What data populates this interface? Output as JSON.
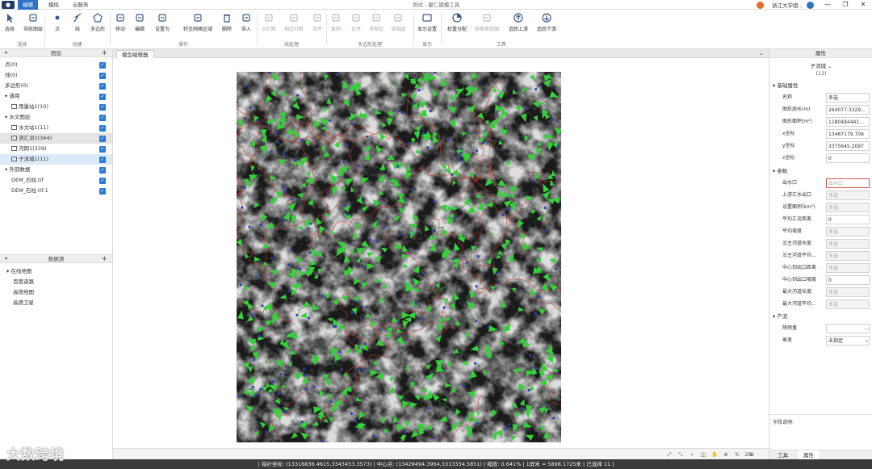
{
  "titlebar": {
    "app_title": "测试 - 量仁建模工具",
    "tabs": [
      "编辑",
      "模拟",
      "云服务"
    ],
    "active_tab": "编辑",
    "user_name": "浙江大学祖…",
    "win_min": "—",
    "win_restore": "❐",
    "win_close": "✕"
  },
  "ribbon": {
    "tools": [
      {
        "label": "选择",
        "icon": "cursor-icon"
      },
      {
        "label": "导航图层",
        "icon": "nav-layer-icon"
      },
      {
        "label": "点",
        "icon": "point-icon"
      },
      {
        "label": "线",
        "icon": "line-icon"
      },
      {
        "label": "多边形",
        "icon": "polygon-icon"
      },
      {
        "label": "移动",
        "icon": "move-icon"
      },
      {
        "label": "编辑",
        "icon": "pencil-icon"
      },
      {
        "label": "设置为",
        "icon": "set-as-icon"
      },
      {
        "label": "转至网格区域",
        "icon": "swap-icon"
      },
      {
        "label": "删除",
        "icon": "trash-icon"
      },
      {
        "label": "导入",
        "icon": "import-icon"
      },
      {
        "label": "点打断",
        "icon": "point-break-icon"
      },
      {
        "label": "相交打断",
        "icon": "intersect-break-icon"
      },
      {
        "label": "合并",
        "icon": "merge-icon"
      },
      {
        "label": "复制",
        "icon": "copy-icon"
      },
      {
        "label": "合并",
        "icon": "merge2-icon"
      },
      {
        "label": "求相交",
        "icon": "intersect-icon"
      },
      {
        "label": "求相减",
        "icon": "subtract-icon"
      },
      {
        "label": "显示设置",
        "icon": "display-icon"
      },
      {
        "label": "权重分配",
        "icon": "pie-icon"
      },
      {
        "label": "纵断面视图",
        "icon": "profile-icon"
      },
      {
        "label": "追踪上游",
        "icon": "upstream-icon"
      },
      {
        "label": "追踪下游",
        "icon": "downstream-icon"
      }
    ],
    "groups": [
      "选择",
      "创建",
      "操作",
      "线处理",
      "多边形处理",
      "显示",
      "工具"
    ]
  },
  "layers_panel": {
    "title": "图层",
    "items": [
      {
        "label": "点(0)",
        "indent": 0
      },
      {
        "label": "线(0)",
        "indent": 0
      },
      {
        "label": "多边形(0)",
        "indent": 0
      },
      {
        "label": "▾ 通用",
        "indent": 0
      },
      {
        "label": "雨量站1(10)",
        "indent": 1,
        "icon": "rain-station-icon"
      },
      {
        "label": "▾ 水文图层",
        "indent": 0
      },
      {
        "label": "水文站1(11)",
        "indent": 1,
        "icon": "hydro-station-icon"
      },
      {
        "label": "流汇点1(344)",
        "indent": 1,
        "icon": "junction-icon"
      },
      {
        "label": "河网1(339)",
        "indent": 1,
        "icon": "river-network-icon"
      },
      {
        "label": "子流域1(11)",
        "indent": 1,
        "icon": "subbasin-icon"
      },
      {
        "label": "▾ 外部数据",
        "indent": 0
      },
      {
        "label": "DEM_石柱.tif",
        "indent": 1
      },
      {
        "label": "DEM_石柱.tif-1",
        "indent": 1
      }
    ],
    "checked_mark": "✓"
  },
  "datasource_panel": {
    "title": "数据源",
    "root": "▾ 在线地图",
    "items": [
      "百度道路",
      "高德地图",
      "高德卫星"
    ]
  },
  "document": {
    "tab_label": "模型编辑器",
    "collapse": "⌄"
  },
  "map_toolbar": {
    "buttons": [
      "⤢",
      "⤡",
      "⌕",
      "◫",
      "✋",
      "⊕",
      "↻",
      "2D",
      "⊞"
    ]
  },
  "properties": {
    "header": "属性",
    "selector": "子流域 ⌄",
    "count": "(11)",
    "sections": [
      "▾ 基础属性",
      "▾ 参数",
      "▾ 产流"
    ],
    "basic": [
      {
        "label": "名称",
        "value": "多选"
      },
      {
        "label": "图形周长(m)",
        "value": "264077.3329…"
      },
      {
        "label": "图形面积(m²)",
        "value": "1180484441…"
      },
      {
        "label": "x坐标",
        "value": "13467179.706"
      },
      {
        "label": "y坐标",
        "value": "3375645.2097"
      },
      {
        "label": "z坐标",
        "value": "0"
      }
    ],
    "params": [
      {
        "label": "出水口",
        "value": "出水口",
        "style": "err"
      },
      {
        "label": "上游汇水出口",
        "value": "多选",
        "style": "ph"
      },
      {
        "label": "设置面积(km²)",
        "value": "多选",
        "style": "ph"
      },
      {
        "label": "平均汇流距离",
        "value": "0",
        "style": ""
      },
      {
        "label": "平均坡度",
        "value": "多选",
        "style": "ph"
      },
      {
        "label": "沿主河道长度",
        "value": "多选",
        "style": "ph"
      },
      {
        "label": "沿主河道平均…",
        "value": "多选",
        "style": "ph"
      },
      {
        "label": "中心到出口距离",
        "value": "多选",
        "style": "ph"
      },
      {
        "label": "中心到出口坡度",
        "value": "0",
        "style": ""
      },
      {
        "label": "最大河道长度",
        "value": "多选",
        "style": "ph"
      },
      {
        "label": "最大河道平均…",
        "value": "多选",
        "style": "ph"
      }
    ],
    "runoff": [
      {
        "label": "降雨量",
        "value": "",
        "btn": "…"
      },
      {
        "label": "蒸发",
        "value": "未指定",
        "btn": "⌄"
      }
    ],
    "description_label": "字段说明:",
    "bottom_tabs": [
      "工具",
      "属性"
    ]
  },
  "statusbar": {
    "text": "| 指针坐标: (13316836.4615,3343453.3573) | 中心点: (13428494.3964,3313334.5851) | 缩放: 0.641% | 1屏米 = 5898.1725米 | 已选择 11 |"
  },
  "watermark": "大数跨境",
  "colors": {
    "accent": "#2f73c9",
    "arrow_green": "#35d13a",
    "boundary_red": "#c0392b",
    "node_blue": "#2b3fb5"
  }
}
